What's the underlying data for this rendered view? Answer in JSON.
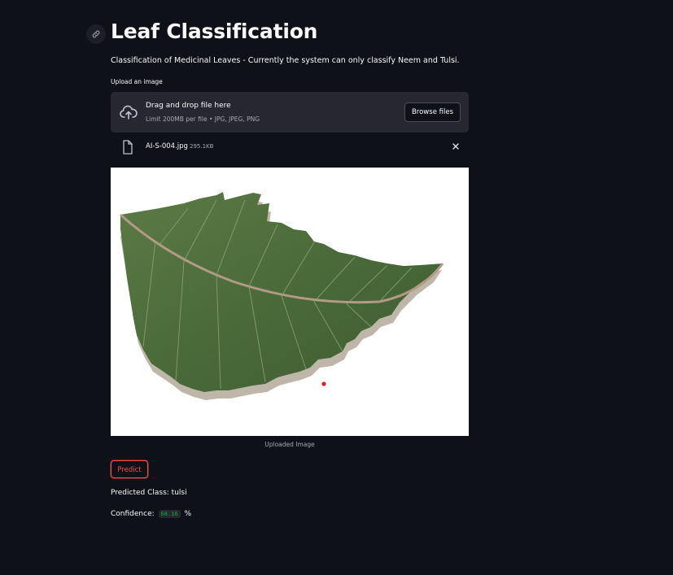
{
  "page": {
    "title": "Leaf Classification",
    "subtitle": "Classification of Medicinal Leaves - Currently the system can only classify Neem and Tulsi."
  },
  "uploader": {
    "label": "Upload an image",
    "drag_text": "Drag and drop file here",
    "limit_text": "Limit 200MB per file • JPG, JPEG, PNG",
    "browse_label": "Browse files"
  },
  "file": {
    "name": "AI-S-004.jpg",
    "size": "295.1KB"
  },
  "image": {
    "caption": "Uploaded Image",
    "subject": "green serrated leaf"
  },
  "actions": {
    "predict_label": "Predict"
  },
  "result": {
    "predicted_class_text": "Predicted Class: tulsi",
    "confidence_label": "Confidence:",
    "confidence_value": "68.16",
    "confidence_unit": "%"
  },
  "colors": {
    "background": "#0e1117",
    "surface": "#262730",
    "accent": "#ff4b4b",
    "code_green": "#09ab3b"
  }
}
